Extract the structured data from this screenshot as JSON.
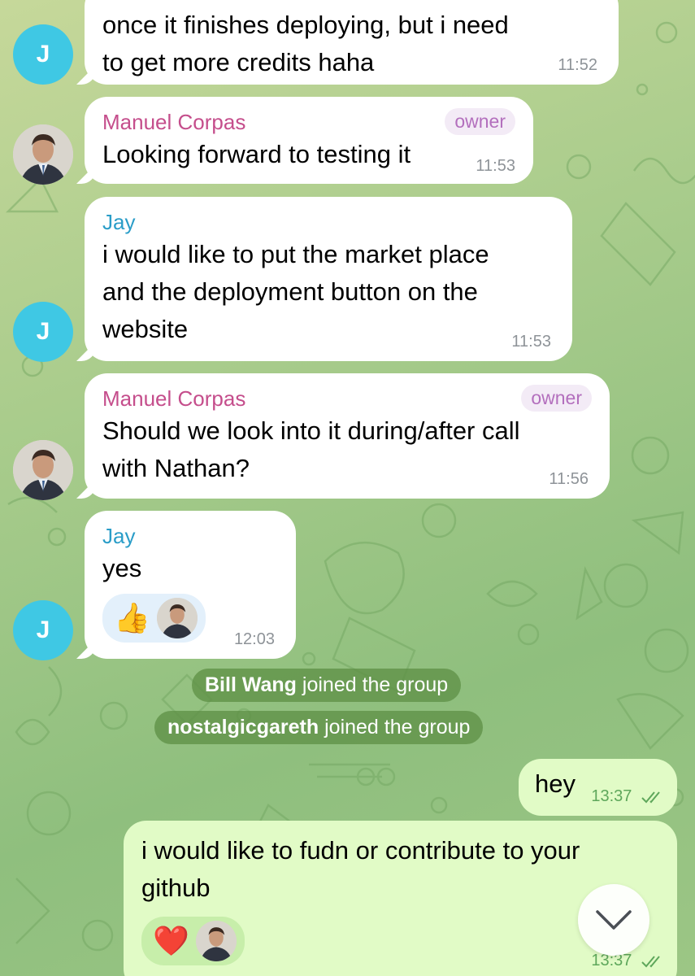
{
  "messages": [
    {
      "sender": "",
      "lines": [
        "once it finishes deploying, but i need",
        "to get more credits haha"
      ],
      "time": "11:52"
    },
    {
      "sender": "Manuel Corpas",
      "badge": "owner",
      "lines": [
        "Looking forward to testing it"
      ],
      "time": "11:53"
    },
    {
      "sender": "Jay",
      "lines": [
        "i would like to put the market place",
        "and the deployment button on the",
        "website"
      ],
      "time": "11:53"
    },
    {
      "sender": "Manuel Corpas",
      "badge": "owner",
      "lines": [
        "Should we look into it during/after call",
        "with Nathan?"
      ],
      "time": "11:56"
    },
    {
      "sender": "Jay",
      "lines": [
        "yes"
      ],
      "reaction": "👍",
      "time": "12:03"
    }
  ],
  "avatar_letter": "J",
  "service": [
    {
      "name": "Bill Wang",
      "action": "joined the group"
    },
    {
      "name": "nostalgicgareth",
      "action": "joined the group"
    }
  ],
  "outgoing": [
    {
      "lines": [
        "hey"
      ],
      "time": "13:37"
    },
    {
      "lines": [
        "i would like to fudn or contribute to your",
        "github"
      ],
      "reaction": "❤️",
      "time": "13:37"
    }
  ],
  "icons": {
    "scroll": "chevron-down-icon",
    "read": "double-check-icon"
  },
  "colors": {
    "jay_avatar": "#3fc8e4",
    "owner_name": "#c54e8c",
    "jay_name": "#2a9dc8",
    "outgoing_bubble": "#e1fbc6"
  }
}
